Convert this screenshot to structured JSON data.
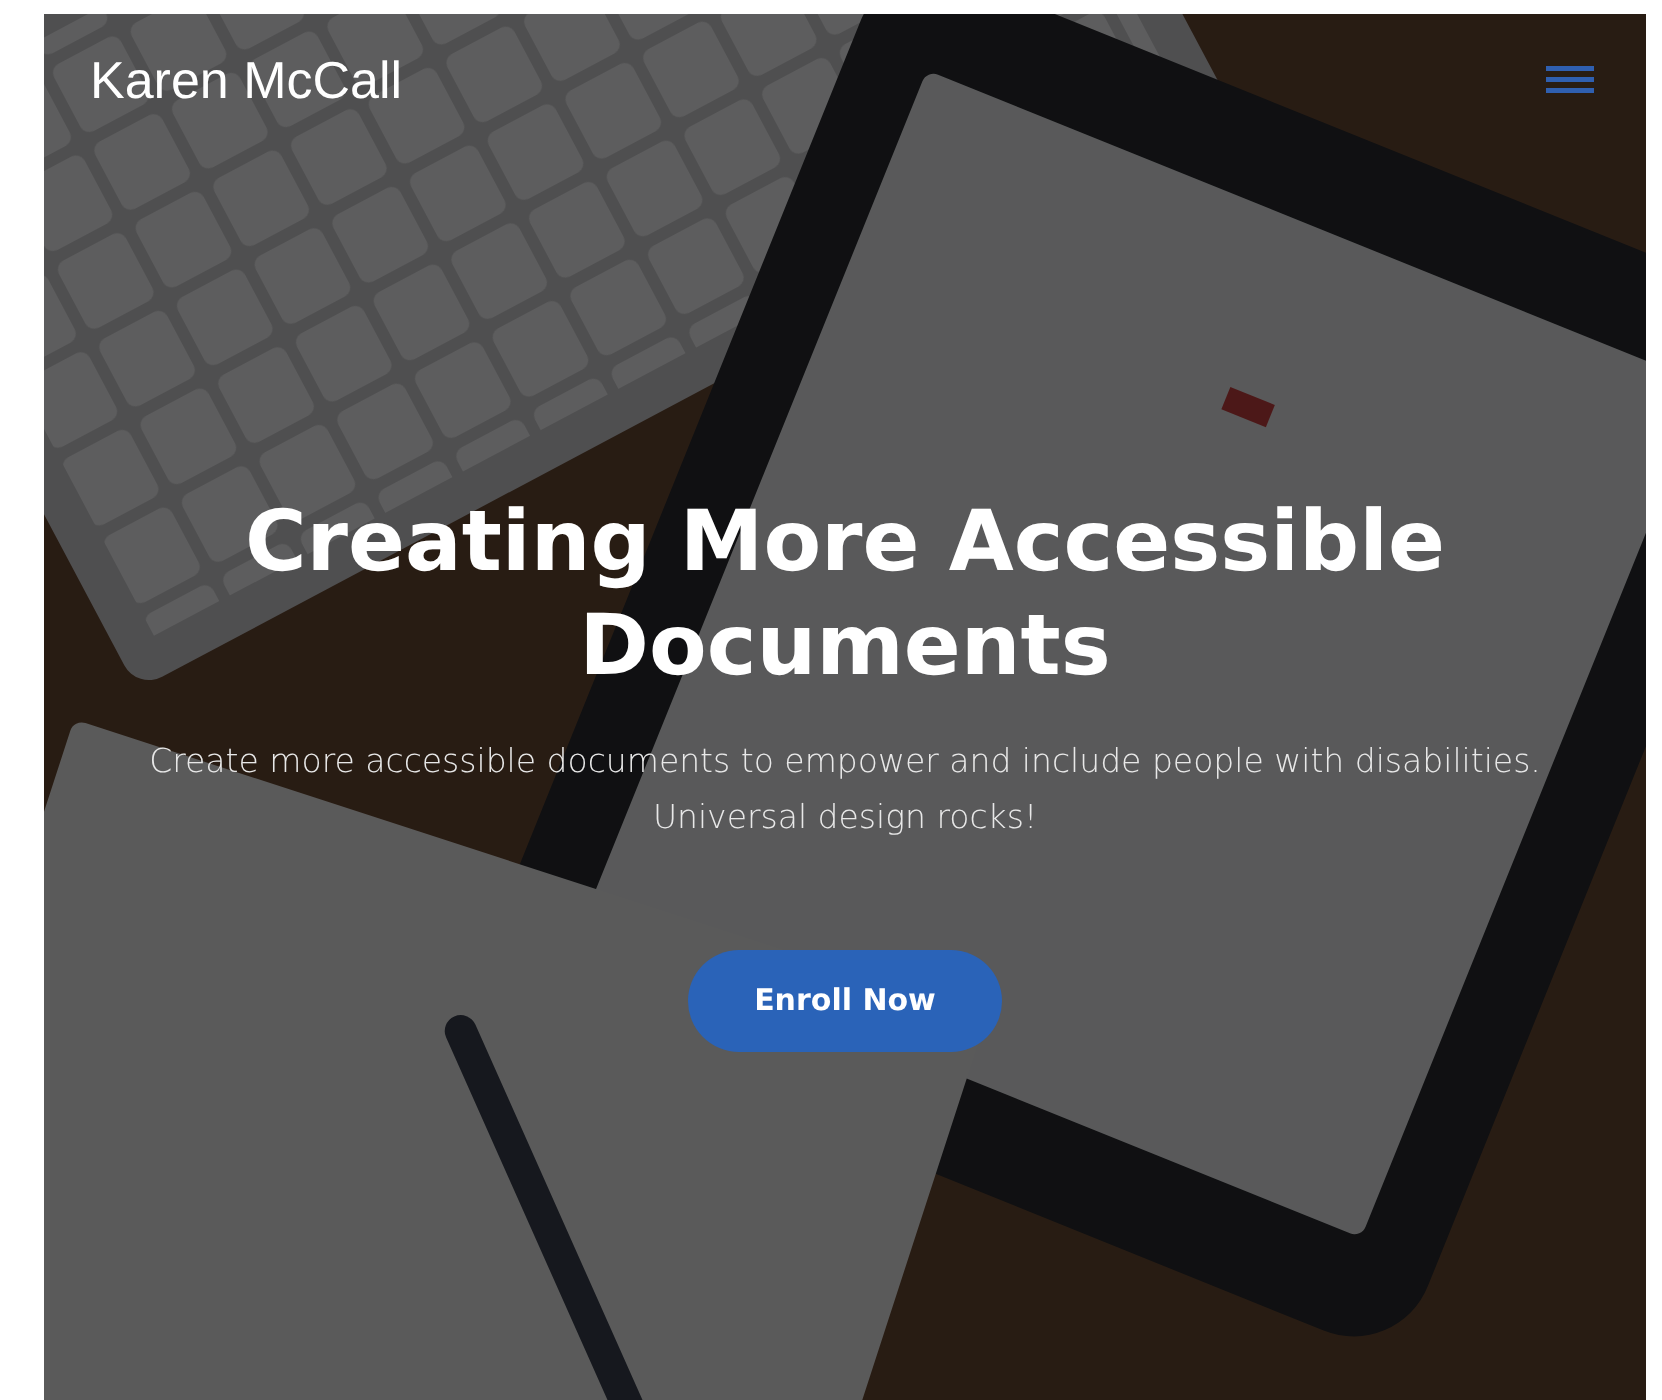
{
  "navbar": {
    "brand": "Karen McCall"
  },
  "hero": {
    "title": "Creating More Accessible Documents",
    "subtitle": "Create more accessible documents to empower and include people with disabilities. Universal design rocks!",
    "button": "Enroll Now"
  }
}
